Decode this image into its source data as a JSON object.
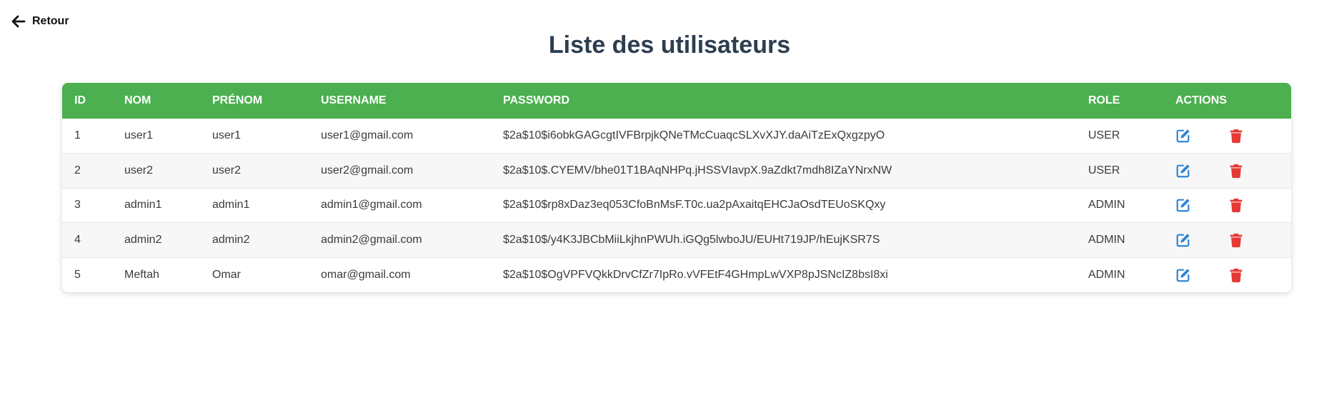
{
  "nav": {
    "back_label": "Retour",
    "back_icon": "arrow-left-icon"
  },
  "page": {
    "title": "Liste des utilisateurs"
  },
  "colors": {
    "header_bg": "#4caf50",
    "title": "#2c3e50",
    "edit_icon": "#2f86d6",
    "delete_icon": "#e53935"
  },
  "table": {
    "headers": {
      "id": "ID",
      "nom": "Nom",
      "prenom": "Prénom",
      "username": "Username",
      "password": "Password",
      "role": "Role",
      "actions": "Actions"
    },
    "rows": [
      {
        "id": "1",
        "nom": "user1",
        "prenom": "user1",
        "username": "user1@gmail.com",
        "password": "$2a$10$i6obkGAGcgtIVFBrpjkQNeTMcCuaqcSLXvXJY.daAiTzExQxgzpyO",
        "role": "USER"
      },
      {
        "id": "2",
        "nom": "user2",
        "prenom": "user2",
        "username": "user2@gmail.com",
        "password": "$2a$10$.CYEMV/bhe01T1BAqNHPq.jHSSVIavpX.9aZdkt7mdh8IZaYNrxNW",
        "role": "USER"
      },
      {
        "id": "3",
        "nom": "admin1",
        "prenom": "admin1",
        "username": "admin1@gmail.com",
        "password": "$2a$10$rp8xDaz3eq053CfoBnMsF.T0c.ua2pAxaitqEHCJaOsdTEUoSKQxy",
        "role": "ADMIN"
      },
      {
        "id": "4",
        "nom": "admin2",
        "prenom": "admin2",
        "username": "admin2@gmail.com",
        "password": "$2a$10$/y4K3JBCbMiiLkjhnPWUh.iGQg5lwboJU/EUHt719JP/hEujKSR7S",
        "role": "ADMIN"
      },
      {
        "id": "5",
        "nom": "Meftah",
        "prenom": "Omar",
        "username": "omar@gmail.com",
        "password": "$2a$10$OgVPFVQkkDrvCfZr7IpRo.vVFEtF4GHmpLwVXP8pJSNcIZ8bsI8xi",
        "role": "ADMIN"
      }
    ],
    "row_action_icons": {
      "edit": "edit-icon",
      "delete": "trash-icon"
    }
  }
}
